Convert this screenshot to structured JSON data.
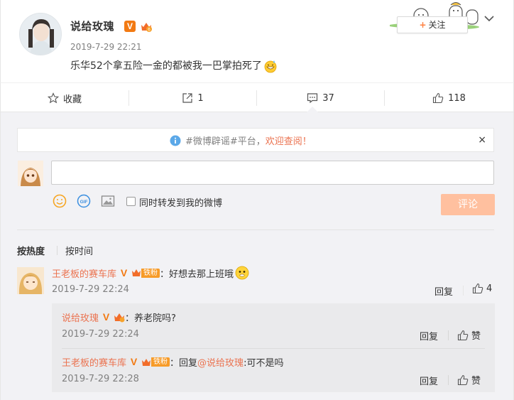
{
  "post": {
    "username": "说给玫瑰",
    "verified_badge": "V",
    "time": "2019-7-29 22:21",
    "text": "乐华52个拿五险一金的都被我一巴掌拍死了",
    "follow_label": "关注",
    "follow_icon": "+"
  },
  "actions": {
    "favorite": "收藏",
    "repost": "1",
    "comment": "37",
    "like": "118"
  },
  "notice": {
    "prefix": "#微博辟谣#平台，",
    "highlight": "欢迎查阅！",
    "close": "×"
  },
  "composer": {
    "input_value": "",
    "repost_label": "同时转发到我的微博",
    "submit_label": "评论",
    "gif_label": "GIF"
  },
  "sort": {
    "hot": "按热度",
    "time": "按时间"
  },
  "comments": [
    {
      "user": "王老板的赛车库",
      "verified": "V",
      "fan_badge": "铁粉",
      "colon": "：",
      "text": "好想去那上班哦",
      "time": "2019-7-29 22:24",
      "reply_label": "回复",
      "likes": "4",
      "replies": [
        {
          "user": "说给玫瑰",
          "verified": "V",
          "colon": "：",
          "text": "养老院吗?",
          "time": "2019-7-29 22:24",
          "reply_label": "回复",
          "like_label": "赞"
        },
        {
          "user": "王老板的赛车库",
          "verified": "V",
          "fan_badge": "铁粉",
          "colon": "：",
          "reply_prefix": "回复",
          "mention": "@说给玫瑰",
          "text": ":可不是吗",
          "time": "2019-7-29 22:28",
          "reply_label": "回复",
          "like_label": "赞"
        }
      ]
    }
  ],
  "colors": {
    "accent": "#eb7350",
    "vip_orange": "#f27a13",
    "submit_disabled": "#ffc09f",
    "comment_bg": "#f2f2f5"
  }
}
